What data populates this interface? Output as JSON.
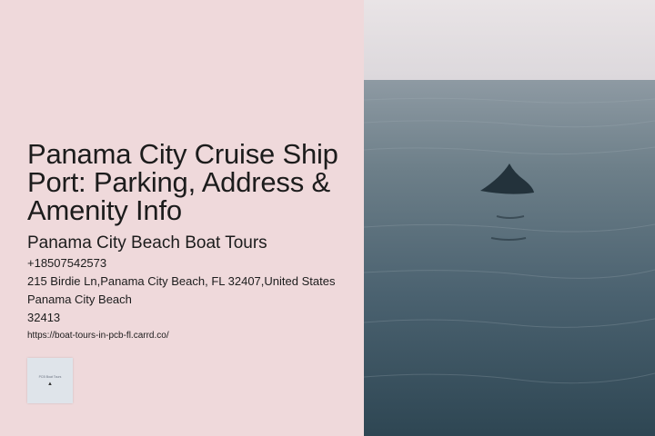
{
  "hero": {
    "title": "Panama City Cruise Ship Port: Parking, Address & Amenity Info"
  },
  "business": {
    "name": "Panama City Beach Boat Tours",
    "phone": "+18507542573",
    "address": "215 Birdie Ln,Panama City Beach, FL 32407,United States",
    "city": "Panama City Beach",
    "zip": "32413",
    "url": "https://boat-tours-in-pcb-fl.carrd.co/"
  },
  "logo": {
    "text": "PCB Boat Tours",
    "icon": "dolphin-icon"
  },
  "colors": {
    "panel_background": "#efd9db",
    "text": "#1c1c1c"
  }
}
